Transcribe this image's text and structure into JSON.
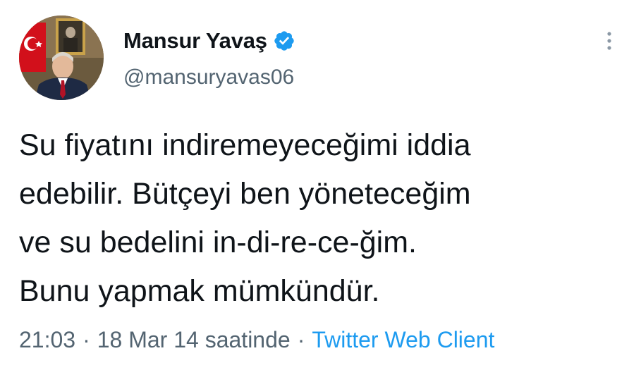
{
  "author": {
    "display_name": "Mansur Yavaş",
    "handle": "@mansuryavas06",
    "verified_icon": "verified-badge-icon",
    "avatar": "profile-photo"
  },
  "tweet": {
    "lines": [
      "Su fiyatını indiremeyeceğimi iddia",
      "edebilir. Bütçeyi ben yöneteceğim",
      "ve su bedelini in-di-re-ce-ğim.",
      "Bunu yapmak mümkündür."
    ]
  },
  "meta": {
    "time": "21:03",
    "separator": "·",
    "date": "18 Mar 14 saatinde",
    "source": "Twitter Web Client"
  },
  "colors": {
    "text": "#0f1419",
    "secondary": "#536471",
    "accent": "#1d9bf0"
  },
  "icons": {
    "more": "more-vertical-icon"
  }
}
